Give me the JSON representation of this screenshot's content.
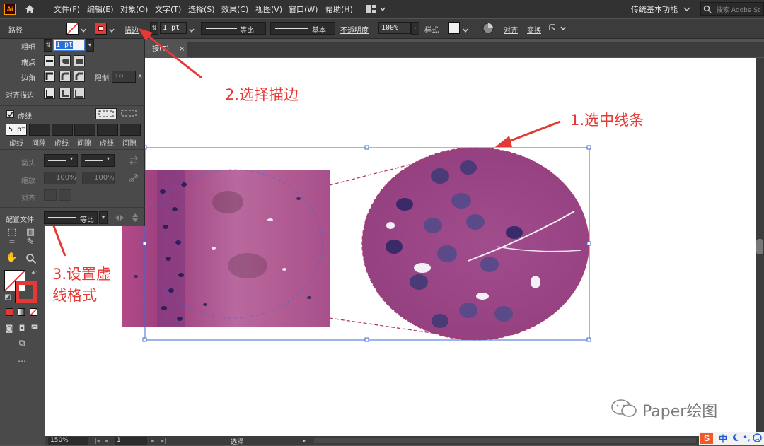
{
  "menubar": {
    "logo": "Ai",
    "items": [
      "文件(F)",
      "编辑(E)",
      "对象(O)",
      "文字(T)",
      "选择(S)",
      "效果(C)",
      "视图(V)",
      "窗口(W)",
      "帮助(H)"
    ],
    "workspace": "传统基本功能",
    "search_placeholder": "搜索 Adobe St"
  },
  "control_bar": {
    "object_type": "路径",
    "stroke_label": "描边",
    "stroke_weight": "1 pt",
    "profile": "等比",
    "brush": "基本",
    "opacity_label": "不透明度",
    "opacity_value": "100%",
    "style_label": "样式",
    "align_label": "对齐",
    "transform_label": "变换"
  },
  "stroke_panel": {
    "weight_label": "粗细",
    "weight_value": "1 pt",
    "cap_label": "端点",
    "corner_label": "边角",
    "limit_label": "限制",
    "limit_value": "10",
    "limit_unit": "x",
    "align_label": "对齐描边",
    "dashed_label": "虚线",
    "dashed_checked": true,
    "dash_first_value": "5 pt",
    "dash_labels": [
      "虚线",
      "间隙",
      "虚线",
      "间隙",
      "虚线",
      "间隙"
    ],
    "arrowhead_label": "箭头",
    "scale_label": "缩放",
    "scale_values": [
      "100%",
      "100%"
    ],
    "align_arrow_label": "对齐",
    "profile_label": "配置文件",
    "profile_value": "等比"
  },
  "document_tab": {
    "label": "J 接(T)",
    "close": "×"
  },
  "status_bar": {
    "zoom": "150%",
    "page": "1",
    "tool": "选择"
  },
  "annotations": {
    "step1": "1.选中线条",
    "step2": "2.选择描边",
    "step3_line1": "3.设置虚",
    "step3_line2": "线格式"
  },
  "watermark": "Paper绘图",
  "tray": {
    "ime": "中"
  },
  "colors": {
    "annotation_red": "#e53935",
    "selection_blue": "#3c6bd6",
    "ui_dark": "#323232",
    "panel": "#4a4a4a",
    "tissue_pink": "#a5457f",
    "nuclei_purple": "#3a2a6a"
  }
}
